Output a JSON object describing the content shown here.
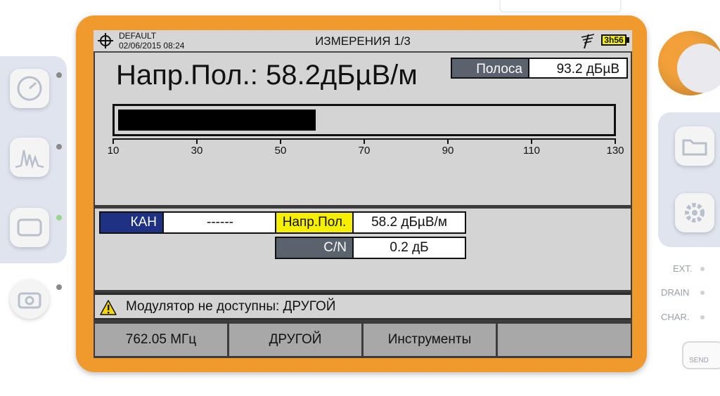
{
  "status_bar": {
    "profile": "DEFAULT",
    "datetime": "02/06/2015 08:24",
    "title": "ИЗМЕРЕНИЯ 1/3",
    "battery": "3h56",
    "icons": [
      "target-icon",
      "antenna-icon",
      "battery-icon"
    ]
  },
  "measurement": {
    "label": "Напр.Пол.:",
    "value": "58.2",
    "unit": "дБµВ/м",
    "band_label": "Полоса",
    "band_value": "93.2 дБµВ",
    "bar": {
      "min": 10,
      "max": 130,
      "value": 58.2
    },
    "scale_labels": [
      "10",
      "30",
      "50",
      "70",
      "90",
      "110",
      "130"
    ]
  },
  "channel": {
    "kan_label": "КАН",
    "kan_value": "------",
    "level_label": "Напр.Пол.",
    "level_value": "58.2 дБµВ/м",
    "cn_label": "C/N",
    "cn_value": "0.2 дБ"
  },
  "warning": {
    "icon": "warning-icon",
    "text": "Модулятор не доступны: ДРУГОЙ"
  },
  "softkeys": [
    "762.05 МГц",
    "ДРУГОЙ",
    "Инструменты",
    ""
  ],
  "device": {
    "right_labels": [
      "EXT.",
      "DRAIN",
      "CHAR."
    ],
    "send_label": "SEND"
  },
  "colors": {
    "bezel": "#f09a2e",
    "channel_label_bg": "#1e3183",
    "highlight_yellow": "#f6ef00",
    "label_gray": "#59626d",
    "panel_bg": "#d4d4d4"
  }
}
